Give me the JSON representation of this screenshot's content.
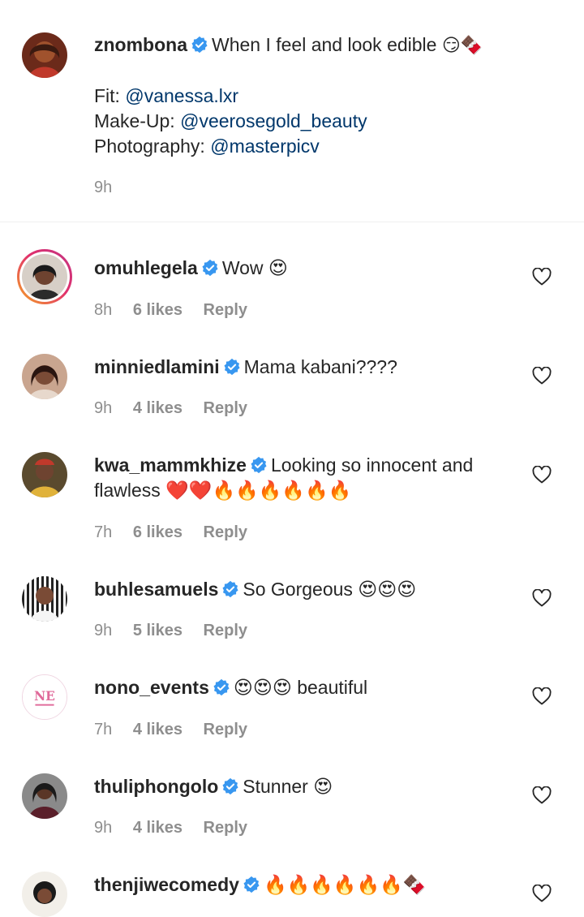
{
  "caption": {
    "username": "znombona",
    "text": "When I feel and look edible",
    "emojis": "😏🍫",
    "fit_label": "Fit:",
    "fit_mention": "@vanessa.lxr",
    "makeup_label": "Make-Up:",
    "makeup_mention": "@veerosegold_beauty",
    "photo_label": "Photography:",
    "photo_mention": "@masterpicv",
    "time": "9h"
  },
  "comments": [
    {
      "username": "omuhlegela",
      "text": "Wow 😍",
      "time": "8h",
      "likes": "6 likes",
      "reply": "Reply"
    },
    {
      "username": "minniedlamini",
      "text": "Mama kabani????",
      "time": "9h",
      "likes": "4 likes",
      "reply": "Reply"
    },
    {
      "username": "kwa_mammkhize",
      "text": "Looking so innocent and",
      "text2": "flawless ❤️❤️🔥🔥🔥🔥🔥🔥",
      "time": "7h",
      "likes": "6 likes",
      "reply": "Reply"
    },
    {
      "username": "buhlesamuels",
      "text": "So Gorgeous 😍😍😍",
      "time": "9h",
      "likes": "5 likes",
      "reply": "Reply"
    },
    {
      "username": "nono_events",
      "text": "😍😍😍 beautiful",
      "time": "7h",
      "likes": "4 likes",
      "reply": "Reply"
    },
    {
      "username": "thuliphongolo",
      "text": "Stunner 😍",
      "time": "9h",
      "likes": "4 likes",
      "reply": "Reply"
    },
    {
      "username": "thenjiwecomedy",
      "text": "🔥🔥🔥🔥🔥🔥🍫"
    }
  ],
  "colors": {
    "verified": "#3897f0",
    "mention": "#00376b",
    "meta": "#8e8e8e"
  },
  "icons": {
    "heart": "heart-outline-icon",
    "verified": "verified-badge-icon"
  }
}
